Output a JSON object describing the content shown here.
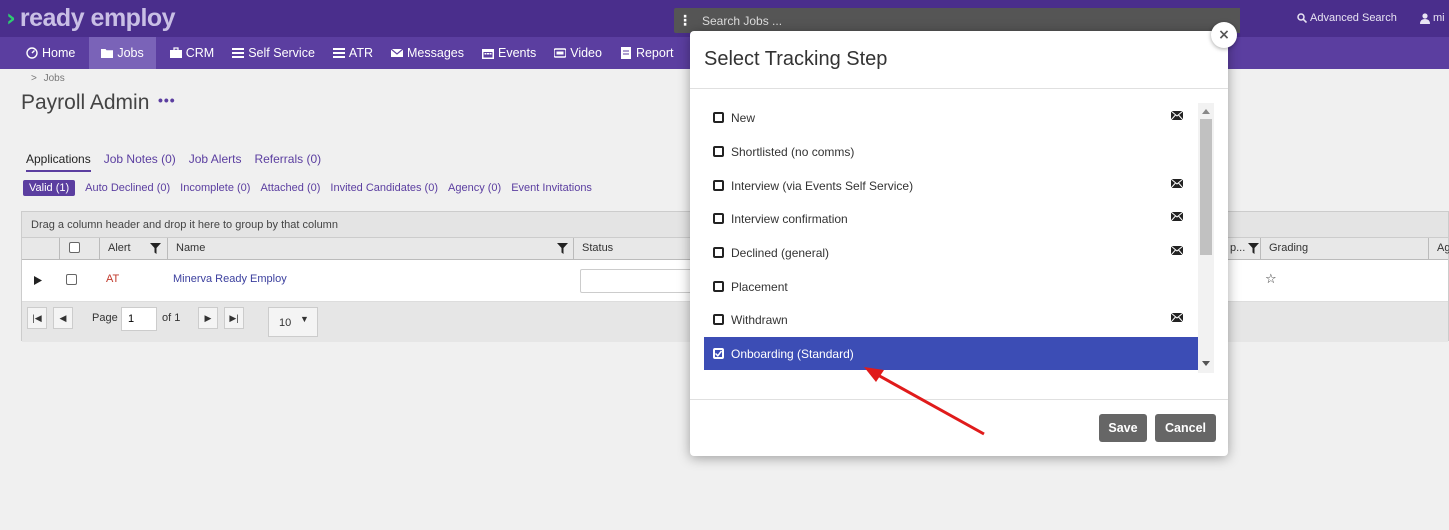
{
  "app": {
    "logo_text": "ready employ"
  },
  "topbar": {
    "search_placeholder": "Search Jobs ...",
    "advanced_search": "Advanced Search",
    "user_label": "mi"
  },
  "nav": [
    {
      "label": "Home",
      "icon": "dashboard-icon"
    },
    {
      "label": "Jobs",
      "icon": "folder-icon",
      "active": true
    },
    {
      "label": "CRM",
      "icon": "briefcase-icon"
    },
    {
      "label": "Self Service",
      "icon": "list-icon"
    },
    {
      "label": "ATR",
      "icon": "list-icon"
    },
    {
      "label": "Messages",
      "icon": "envelope-icon"
    },
    {
      "label": "Events",
      "icon": "calendar-icon"
    },
    {
      "label": "Video",
      "icon": "video-icon"
    },
    {
      "label": "Report",
      "icon": "report-icon"
    }
  ],
  "page": {
    "breadcrumb": "Jobs",
    "title": "Payroll Admin",
    "title_menu": "•••",
    "tabs": [
      "Applications",
      "Job Notes (0)",
      "Job Alerts",
      "Referrals (0)"
    ],
    "subtabs": [
      "Valid (1)",
      "Auto Declined (0)",
      "Incomplete (0)",
      "Attached (0)",
      "Invited Candidates (0)",
      "Agency (0)",
      "Event Invitations"
    ]
  },
  "grid": {
    "group_hint": "Drag a column header and drop it here to group by that column",
    "columns": {
      "alert": "Alert",
      "name": "Name",
      "status": "Status",
      "stage_tail": "p...",
      "grading": "Grading",
      "age_tail": "Ag"
    },
    "row": {
      "alert": "AT",
      "name": "Minerva Ready Employ",
      "grading": "☆"
    },
    "pager": {
      "page_label": "Page",
      "page_value": "1",
      "of_label": "of 1",
      "page_size": "10"
    }
  },
  "modal": {
    "title": "Select Tracking Step",
    "close_glyph": "×",
    "steps": [
      {
        "label": "New",
        "mail": true,
        "checked": false
      },
      {
        "label": "Shortlisted (no comms)",
        "mail": false,
        "checked": false
      },
      {
        "label": "Interview (via Events Self Service)",
        "mail": true,
        "checked": false
      },
      {
        "label": "Interview confirmation",
        "mail": true,
        "checked": false
      },
      {
        "label": "Declined (general)",
        "mail": true,
        "checked": false
      },
      {
        "label": "Placement",
        "mail": false,
        "checked": false
      },
      {
        "label": "Withdrawn",
        "mail": true,
        "checked": false
      },
      {
        "label": "Onboarding (Standard)",
        "mail": false,
        "checked": true
      }
    ],
    "save_label": "Save",
    "cancel_label": "Cancel"
  },
  "colors": {
    "brand": "#4a2e8c",
    "nav": "#5b3ea0",
    "selected": "#3c4db5",
    "arrow": "#e01b1b"
  }
}
